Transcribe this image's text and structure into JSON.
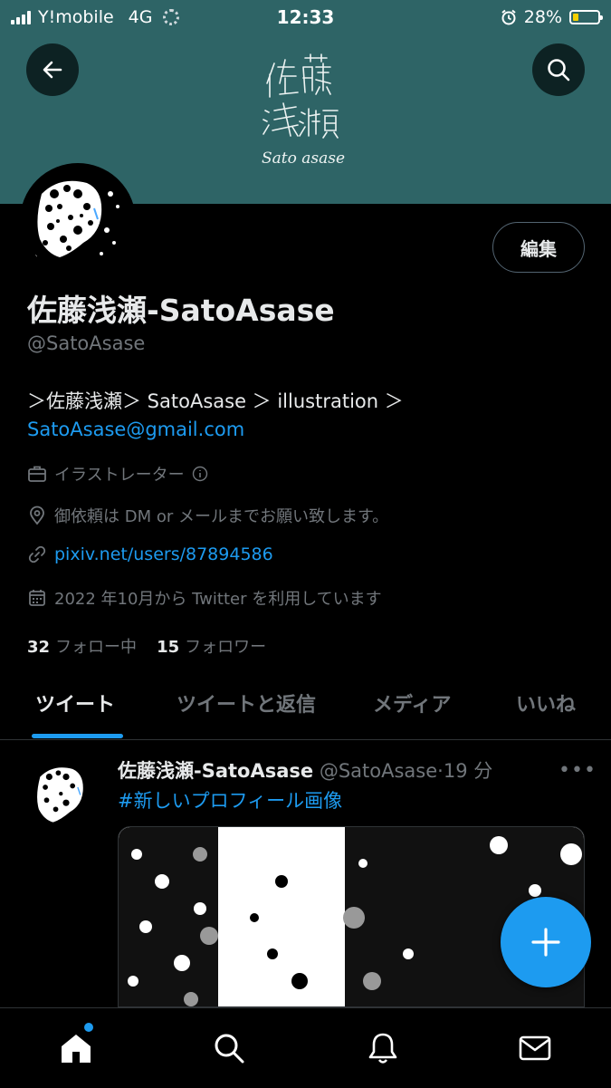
{
  "status_bar": {
    "carrier": "Y!mobile",
    "network": "4G",
    "time": "12:33",
    "battery": "28%",
    "battery_level": 0.28,
    "icons": [
      "signal-icon",
      "loading-icon",
      "alarm-icon",
      "battery-icon"
    ]
  },
  "banner": {
    "background_color": "#2e6466",
    "logo_text": [
      "佐藤",
      "浅瀬",
      "Sato asase"
    ]
  },
  "header_actions": {
    "back_icon": "arrow-left-icon",
    "search_icon": "search-icon"
  },
  "profile": {
    "edit_label": "編集",
    "display_name": "佐藤浅瀬-SatoAsase",
    "handle": "@SatoAsase",
    "bio_line1": "＞佐藤浅瀬＞ SatoAsase ＞ illustration ＞",
    "bio_email": "SatoAsase@gmail.com",
    "category": "イラストレーター",
    "location": "御依頼は DM or メールまでお願い致します。",
    "website": "pixiv.net/users/87894586",
    "joined": "2022 年10月から Twitter を利用しています",
    "following_count": "32",
    "following_label": "フォロー中",
    "followers_count": "15",
    "followers_label": "フォロワー"
  },
  "tabs": [
    {
      "label": "ツイート",
      "active": true
    },
    {
      "label": "ツイートと返信",
      "active": false
    },
    {
      "label": "メディア",
      "active": false
    },
    {
      "label": "いいね",
      "active": false
    }
  ],
  "tweet": {
    "name": "佐藤浅瀬-SatoAsase",
    "handle": "@SatoAsase",
    "separator": "·",
    "time": "19 分",
    "more": "•••",
    "hashtag": "#新しいプロフィール画像"
  },
  "fab": {
    "icon": "plus-icon"
  },
  "bottom_nav": [
    {
      "icon": "home-icon",
      "active": true
    },
    {
      "icon": "search-icon",
      "active": false
    },
    {
      "icon": "bell-icon",
      "active": false
    },
    {
      "icon": "mail-icon",
      "active": false
    }
  ],
  "colors": {
    "accent": "#1d9bf0",
    "banner": "#2e6466",
    "text": "#e7e9ea",
    "muted": "#71767b"
  }
}
